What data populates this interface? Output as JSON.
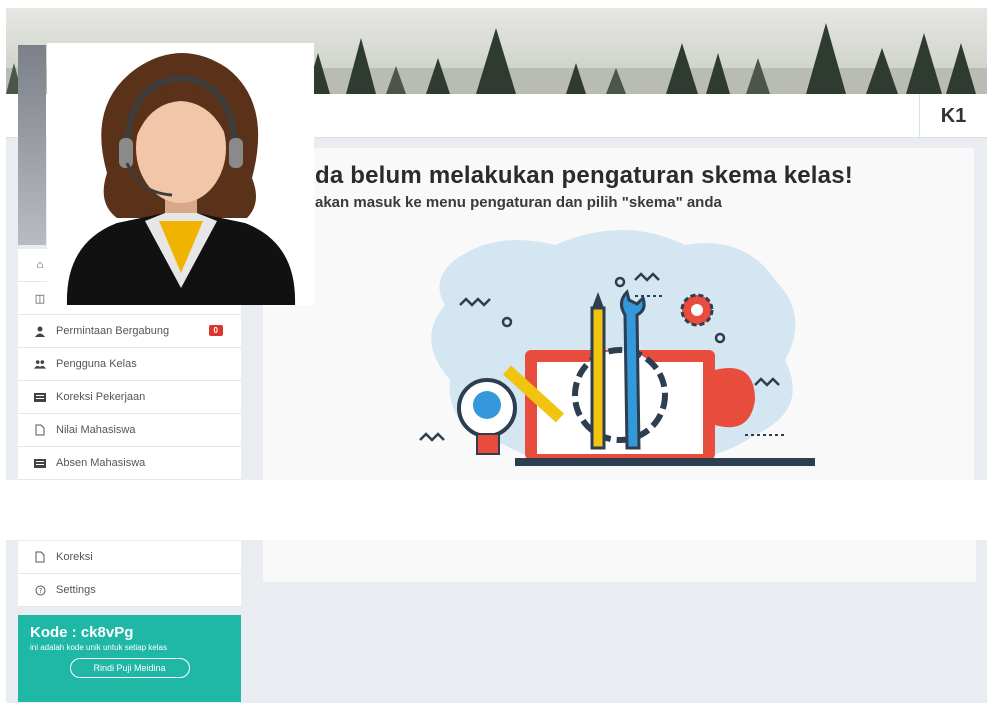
{
  "header": {
    "class_name": "K1"
  },
  "main": {
    "heading": "da belum melakukan pengaturan skema kelas!",
    "subheading": "akan masuk ke menu pengaturan dan pilih \"skema\" anda"
  },
  "sidebar": {
    "items_top": [
      {
        "icon": "home-icon",
        "label": ""
      },
      {
        "icon": "book-icon",
        "label": ""
      },
      {
        "icon": "user-icon",
        "label": "Permintaan Bergabung",
        "badge": "0"
      },
      {
        "icon": "users-icon",
        "label": "Pengguna Kelas"
      },
      {
        "icon": "list-icon",
        "label": "Koreksi Pekerjaan"
      },
      {
        "icon": "file-icon",
        "label": "Nilai Mahasiswa"
      },
      {
        "icon": "list-icon",
        "label": "Absen Mahasiswa"
      }
    ],
    "items_bottom": [
      {
        "icon": "file-icon",
        "label": "Koreksi"
      },
      {
        "icon": "help-circle-icon",
        "label": "Settings"
      }
    ]
  },
  "kode": {
    "title": "Kode : ck8vPg",
    "description": "ini adalah kode unik untuk setiap kelas",
    "user_button": "Rindi Puji Meidina"
  },
  "colors": {
    "accent": "#1fb7a6",
    "badge": "#d9362d",
    "page_bg": "#e9ecf1"
  }
}
